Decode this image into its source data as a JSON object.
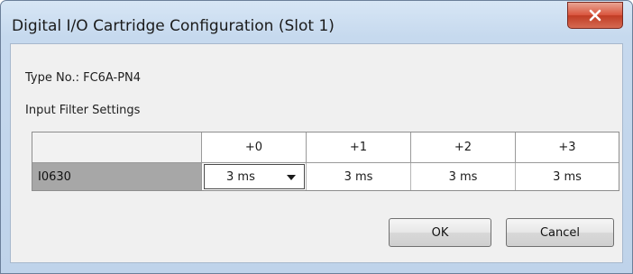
{
  "window": {
    "title": "Digital I/O Cartridge Configuration (Slot 1)",
    "close_icon": "close-icon",
    "close_label": "X"
  },
  "type_label": "Type No.: FC6A-PN4",
  "filter_label": "Input Filter Settings",
  "table": {
    "columns": [
      "+0",
      "+1",
      "+2",
      "+3"
    ],
    "rows": [
      {
        "name": "I0630",
        "values": [
          "3 ms",
          "3 ms",
          "3 ms",
          "3 ms"
        ]
      }
    ],
    "selected_cell": "+0",
    "dropdown_icon": "chevron-down-icon"
  },
  "buttons": {
    "ok": "OK",
    "cancel": "Cancel"
  },
  "colors": {
    "title_bar": "#c6d9ee",
    "close_button": "#d9543d",
    "row_header": "#a7a7a7",
    "client_bg": "#f0f0f0"
  }
}
